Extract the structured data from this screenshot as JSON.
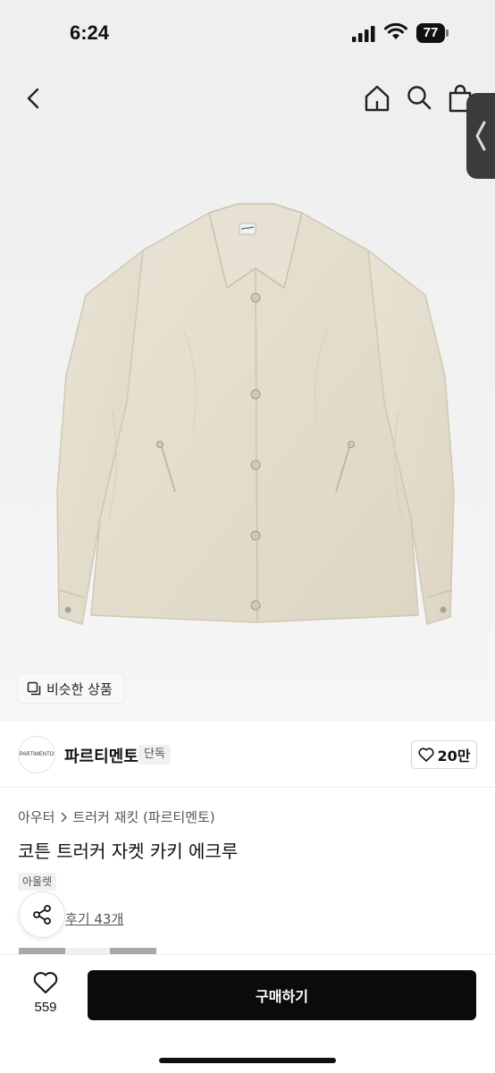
{
  "status_bar": {
    "time": "6:24",
    "battery": "77"
  },
  "nav": {
    "icons": [
      "back-icon",
      "home-icon",
      "search-icon",
      "shopping-bag-icon"
    ]
  },
  "hero": {
    "similar_products_label": "비슷한 상품",
    "brand_print": "PARTIMENTO"
  },
  "brand": {
    "logo_text": "PARTIMENTO",
    "name": "파르티멘토",
    "tag": "단독",
    "like_count": "20만"
  },
  "product": {
    "breadcrumb": [
      "아우터",
      "트러커 재킷 (파르티멘토)"
    ],
    "title": "코튼 트러커 자켓 카키 에크루",
    "badge": "아울렛",
    "review_link": "후기 43개"
  },
  "swatches": [
    "#a9a9a9",
    "#f0f0f0",
    "#a9a9a9"
  ],
  "bottom_bar": {
    "wish_count": "559",
    "buy_label": "구매하기"
  },
  "colors": {
    "jacket": "#e3ddcd",
    "accent_button": "#0b0b0b"
  }
}
